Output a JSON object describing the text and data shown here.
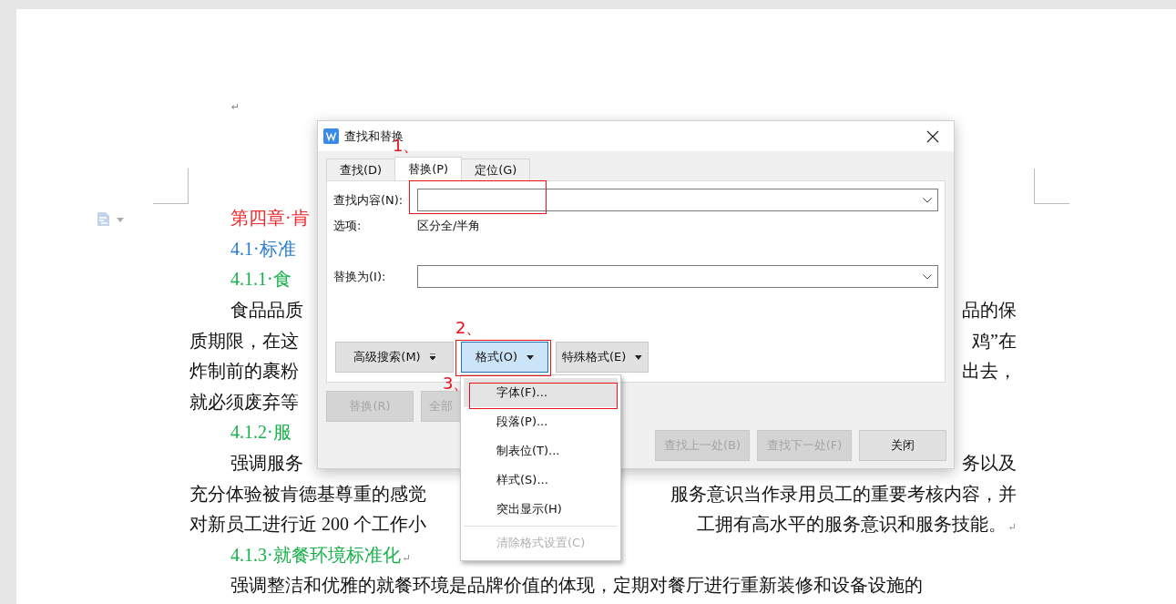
{
  "document": {
    "return_mark": "↵",
    "lines": [
      {
        "kind": "chapter",
        "left": "第四章·肯"
      },
      {
        "kind": "section",
        "left": "4.1·标准"
      },
      {
        "kind": "subsection",
        "left": "4.1.1·食"
      },
      {
        "kind": "para-start",
        "left": "食品品质",
        "right": "品的保"
      },
      {
        "kind": "para",
        "left": "质期限，在这",
        "right": "鸡”在"
      },
      {
        "kind": "para",
        "left": "炸制前的裹粉",
        "right": "出去，"
      },
      {
        "kind": "para",
        "left": "就必须废弃等"
      },
      {
        "kind": "subsection",
        "left": "4.1.2·服"
      },
      {
        "kind": "para-start",
        "left": "强调服务",
        "right": "务以及"
      },
      {
        "kind": "para",
        "left": "充分体验被肯德基尊重的感觉",
        "right": "服务意识当作录用员工的重要考核内容，并"
      },
      {
        "kind": "para",
        "left": "对新员工进行近 200 个工作小",
        "right": "工拥有高水平的服务意识和服务技能。",
        "mark": "↵"
      },
      {
        "kind": "subsection",
        "left": "4.1.3·就餐环境标准化",
        "mark": "↵"
      },
      {
        "kind": "para-start",
        "left": "强调整洁和优雅的就餐环境是品牌价值的体现，定期对餐厅进行重新装修和设备设施的"
      }
    ]
  },
  "dialog": {
    "title": "查找和替换",
    "tabs": [
      {
        "label": "查找(D)",
        "selected": false
      },
      {
        "label": "替换(P)",
        "selected": true
      },
      {
        "label": "定位(G)",
        "selected": false
      }
    ],
    "find": {
      "label": "查找内容(N):"
    },
    "options": {
      "label": "选项:",
      "value": "区分全/半角"
    },
    "replace": {
      "label": "替换为(I):"
    },
    "format_buttons": [
      {
        "label": "高级搜索(M)",
        "active": false,
        "kind": "double-caret"
      },
      {
        "label": "格式(O)",
        "active": true,
        "kind": "caret"
      },
      {
        "label": "特殊格式(E)",
        "active": false,
        "kind": "caret"
      }
    ],
    "replace_buttons": [
      {
        "label": "替换(R)",
        "disabled": true
      },
      {
        "label": "全部",
        "disabled": true
      }
    ],
    "bottom_buttons": [
      {
        "label": "查找上一处(B)",
        "disabled": true
      },
      {
        "label": "查找下一处(F)",
        "disabled": true
      },
      {
        "label": "关闭",
        "disabled": false
      }
    ]
  },
  "format_menu": {
    "items": [
      {
        "kind": "item",
        "label": "字体(F)...",
        "selected": true,
        "disabled": false
      },
      {
        "kind": "item",
        "label": "段落(P)...",
        "selected": false,
        "disabled": false
      },
      {
        "kind": "item",
        "label": "制表位(T)...",
        "selected": false,
        "disabled": false
      },
      {
        "kind": "item",
        "label": "样式(S)...",
        "selected": false,
        "disabled": false
      },
      {
        "kind": "item",
        "label": "突出显示(H)",
        "selected": false,
        "disabled": false
      },
      {
        "kind": "separator"
      },
      {
        "kind": "item",
        "label": "清除格式设置(C)",
        "selected": false,
        "disabled": true
      }
    ]
  },
  "annotations": [
    {
      "label": "1、"
    },
    {
      "label": "2、"
    },
    {
      "label": "3、"
    }
  ]
}
